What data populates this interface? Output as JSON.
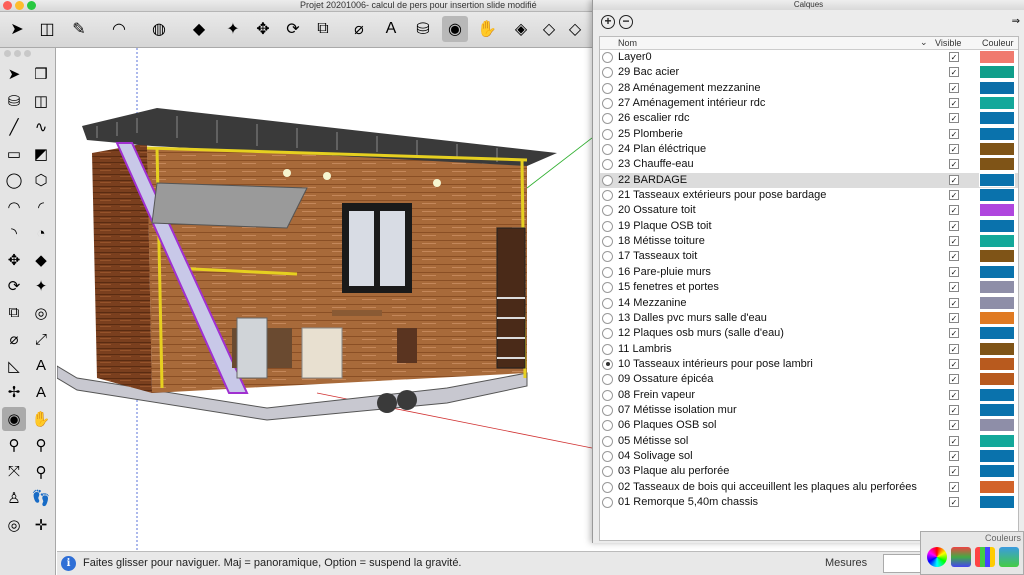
{
  "window": {
    "title": "Projet 20201006- calcul de pers pour insertion slide modifié"
  },
  "toolbar": {
    "items": [
      {
        "icon": "select-arrow-icon",
        "glyph": "➤"
      },
      {
        "icon": "eraser-icon",
        "glyph": "◫"
      },
      {
        "icon": "pencil-line-icon",
        "glyph": "✎"
      },
      {
        "icon": "arc-icon",
        "glyph": "◠"
      },
      {
        "icon": "circle-shape-icon",
        "glyph": "◍"
      },
      {
        "icon": "push-pull-icon",
        "glyph": "◆"
      },
      {
        "icon": "follow-me-icon",
        "glyph": "✦"
      },
      {
        "icon": "move-icon",
        "glyph": "✥"
      },
      {
        "icon": "rotate-icon",
        "glyph": "⟳"
      },
      {
        "icon": "scale-icon",
        "glyph": "⧉"
      },
      {
        "icon": "tape-measure-icon",
        "glyph": "⌀"
      },
      {
        "icon": "text-tool-icon",
        "glyph": "A"
      },
      {
        "icon": "paint-bucket-icon",
        "glyph": "⛁"
      },
      {
        "icon": "orbit-icon",
        "glyph": "◉"
      },
      {
        "icon": "pan-hand-icon",
        "glyph": "✋"
      },
      {
        "icon": "iso-view-icon",
        "glyph": "◈"
      },
      {
        "icon": "top-view-icon",
        "glyph": "◇"
      },
      {
        "icon": "front-view-icon",
        "glyph": "◇"
      },
      {
        "icon": "right-view-icon",
        "glyph": "◇"
      }
    ]
  },
  "left_toolbar": {
    "items": [
      {
        "icon": "select-arrow-icon",
        "glyph": "➤"
      },
      {
        "icon": "make-component-icon",
        "glyph": "❒"
      },
      {
        "icon": "paint-bucket-icon",
        "glyph": "⛁"
      },
      {
        "icon": "eraser-icon",
        "glyph": "◫"
      },
      {
        "icon": "line-icon",
        "glyph": "╱"
      },
      {
        "icon": "freehand-icon",
        "glyph": "∿"
      },
      {
        "icon": "rectangle-icon",
        "glyph": "▭"
      },
      {
        "icon": "rotated-rectangle-icon",
        "glyph": "◩"
      },
      {
        "icon": "circle-icon",
        "glyph": "◯"
      },
      {
        "icon": "polygon-icon",
        "glyph": "⬡"
      },
      {
        "icon": "arc-icon",
        "glyph": "◠"
      },
      {
        "icon": "two-point-arc-icon",
        "glyph": "◜"
      },
      {
        "icon": "three-point-arc-icon",
        "glyph": "◝"
      },
      {
        "icon": "pie-icon",
        "glyph": "◔"
      },
      {
        "icon": "move-icon",
        "glyph": "✥"
      },
      {
        "icon": "push-pull-icon",
        "glyph": "◆"
      },
      {
        "icon": "rotate-icon",
        "glyph": "⟳"
      },
      {
        "icon": "follow-me-icon",
        "glyph": "✦"
      },
      {
        "icon": "scale-icon",
        "glyph": "⧉"
      },
      {
        "icon": "offset-icon",
        "glyph": "◎"
      },
      {
        "icon": "tape-measure-icon",
        "glyph": "⌀"
      },
      {
        "icon": "dimension-icon",
        "glyph": "⤢"
      },
      {
        "icon": "protractor-icon",
        "glyph": "◺"
      },
      {
        "icon": "text-tool-icon",
        "glyph": "A"
      },
      {
        "icon": "axes-icon",
        "glyph": "✢"
      },
      {
        "icon": "3d-text-icon",
        "glyph": "A"
      },
      {
        "icon": "orbit-icon",
        "glyph": "◉"
      },
      {
        "icon": "pan-hand-icon",
        "glyph": "✋"
      },
      {
        "icon": "zoom-icon",
        "glyph": "⚲"
      },
      {
        "icon": "zoom-window-icon",
        "glyph": "⚲"
      },
      {
        "icon": "zoom-extents-icon",
        "glyph": "⤧"
      },
      {
        "icon": "previous-view-icon",
        "glyph": "⚲"
      },
      {
        "icon": "position-camera-icon",
        "glyph": "♙"
      },
      {
        "icon": "walk-icon",
        "glyph": "👣"
      },
      {
        "icon": "look-around-icon",
        "glyph": "◎"
      },
      {
        "icon": "section-plane-icon",
        "glyph": "✛"
      }
    ]
  },
  "status": {
    "text": "Faites glisser pour naviguer. Maj = panoramique, Option =  suspend la gravité.",
    "info_glyph": "i",
    "measurements_label": "Mesures"
  },
  "layers_panel": {
    "title": "Calques",
    "add_glyph": "+",
    "remove_glyph": "−",
    "expand_glyph": "⇒",
    "columns": {
      "name": "Nom",
      "visible": "Visible",
      "color": "Couleur"
    },
    "sort_glyph": "⌄",
    "checkmark": "✓",
    "layers": [
      {
        "name": "Layer0",
        "visible": true,
        "active": false,
        "color": "#f07a6e"
      },
      {
        "name": "29 Bac acier",
        "visible": true,
        "active": false,
        "color": "#0f9e8a"
      },
      {
        "name": "28 Aménagement mezzanine",
        "visible": true,
        "active": false,
        "color": "#0b6ea8"
      },
      {
        "name": "27 Aménagement intérieur rdc",
        "visible": true,
        "active": false,
        "color": "#13a89a"
      },
      {
        "name": "26 escalier rdc",
        "visible": true,
        "active": false,
        "color": "#0a72ac"
      },
      {
        "name": "25 Plomberie",
        "visible": true,
        "active": false,
        "color": "#0a72ac"
      },
      {
        "name": "24 Plan éléctrique",
        "visible": true,
        "active": false,
        "color": "#7f5417"
      },
      {
        "name": "23 Chauffe-eau",
        "visible": true,
        "active": false,
        "color": "#7f5417"
      },
      {
        "name": "22 BARDAGE",
        "visible": true,
        "active": false,
        "color": "#0a72ac"
      },
      {
        "name": "21 Tasseaux extérieurs pour pose bardage",
        "visible": true,
        "active": false,
        "color": "#0a72ac"
      },
      {
        "name": "20 Ossature toit",
        "visible": true,
        "active": false,
        "color": "#b046de"
      },
      {
        "name": "19 Plaque OSB toit",
        "visible": true,
        "active": false,
        "color": "#0a72ac"
      },
      {
        "name": "18 Métisse toiture",
        "visible": true,
        "active": false,
        "color": "#13a89a"
      },
      {
        "name": "17 Tasseaux toit",
        "visible": true,
        "active": false,
        "color": "#7f5417"
      },
      {
        "name": "16 Pare-pluie murs",
        "visible": true,
        "active": false,
        "color": "#0a72ac"
      },
      {
        "name": "15 fenetres et portes",
        "visible": true,
        "active": false,
        "color": "#8e8ea8"
      },
      {
        "name": "14 Mezzanine",
        "visible": true,
        "active": false,
        "color": "#8e8ea8"
      },
      {
        "name": "13 Dalles pvc murs salle d'eau",
        "visible": true,
        "active": false,
        "color": "#e07a22"
      },
      {
        "name": "12 Plaques osb murs (salle d'eau)",
        "visible": true,
        "active": false,
        "color": "#0a72ac"
      },
      {
        "name": "11 Lambris",
        "visible": true,
        "active": false,
        "color": "#7f5417"
      },
      {
        "name": "10 Tasseaux intérieurs pour pose lambri",
        "visible": true,
        "active": true,
        "color": "#b85a1e"
      },
      {
        "name": "09 Ossature épicéa",
        "visible": true,
        "active": false,
        "color": "#b85a1e"
      },
      {
        "name": "08 Frein vapeur",
        "visible": true,
        "active": false,
        "color": "#0a72ac"
      },
      {
        "name": "07 Métisse isolation mur",
        "visible": true,
        "active": false,
        "color": "#0a72ac"
      },
      {
        "name": "06 Plaques OSB sol",
        "visible": true,
        "active": false,
        "color": "#8e8ea8"
      },
      {
        "name": "05 Métisse sol",
        "visible": true,
        "active": false,
        "color": "#13a89a"
      },
      {
        "name": "04  Solivage sol",
        "visible": true,
        "active": false,
        "color": "#0a72ac"
      },
      {
        "name": "03 Plaque alu perforée",
        "visible": true,
        "active": false,
        "color": "#0a72ac"
      },
      {
        "name": "02 Tasseaux de bois qui acceuillent les plaques alu perforées",
        "visible": true,
        "active": false,
        "color": "#d2632a"
      },
      {
        "name": "01 Remorque 5,40m chassis",
        "visible": true,
        "active": false,
        "color": "#0a72ac"
      }
    ]
  },
  "colors_panel": {
    "title": "Couleurs"
  }
}
